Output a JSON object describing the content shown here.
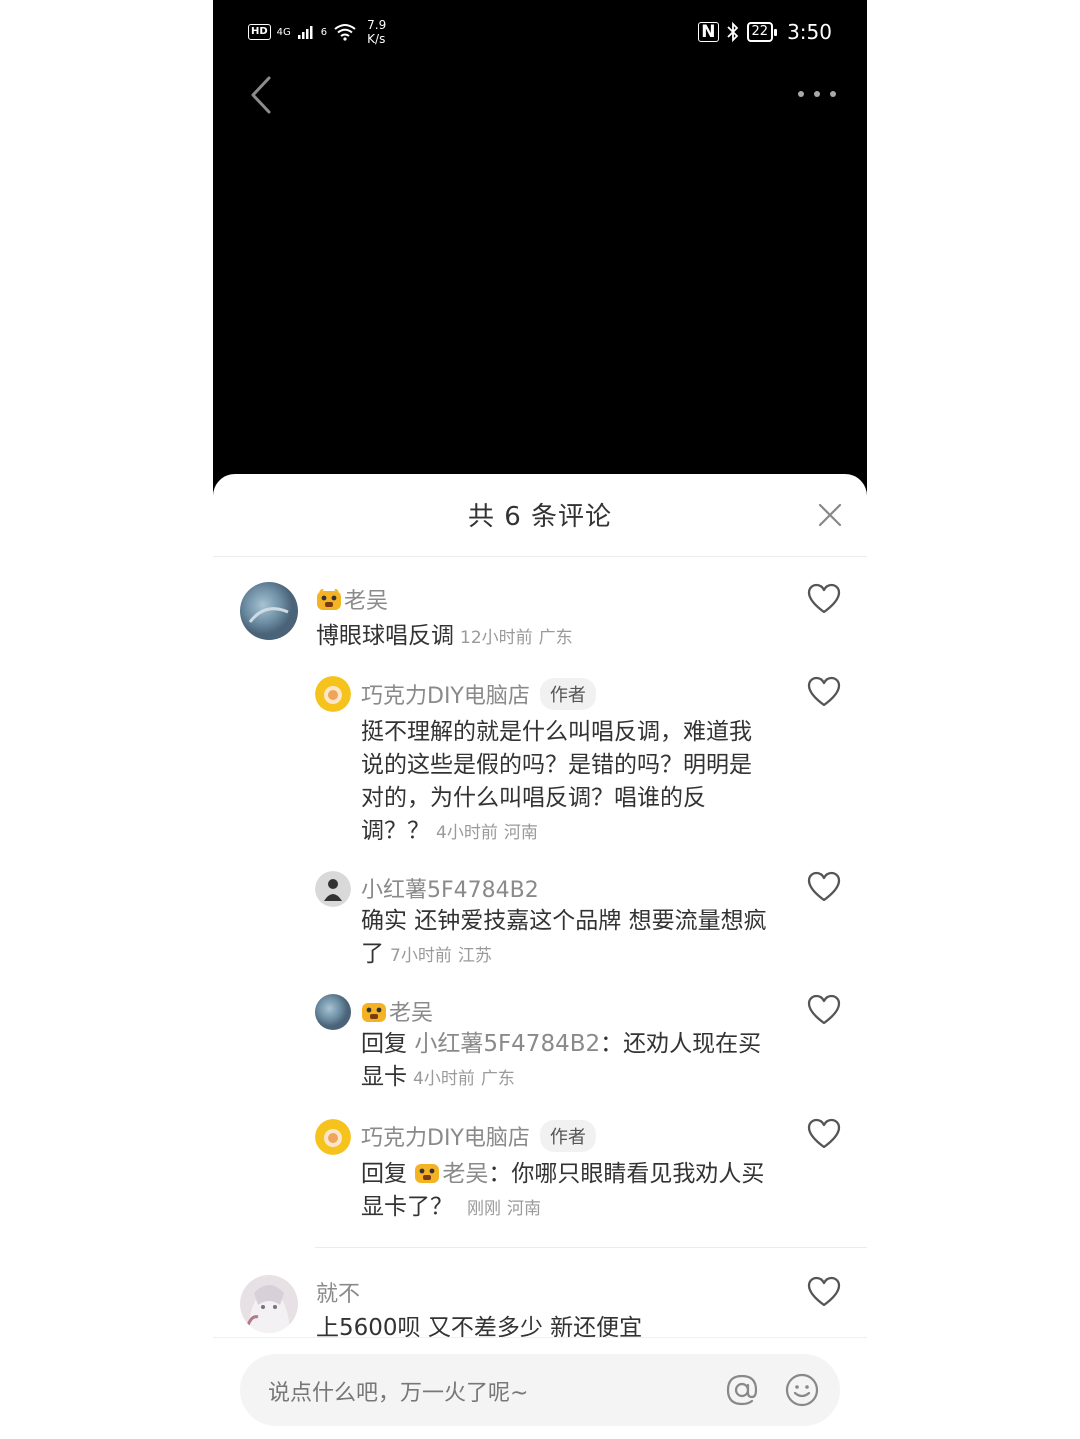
{
  "status_bar": {
    "hd": "HD",
    "network": "4G",
    "wifi_label": "6",
    "speed_value": "7.9",
    "speed_unit": "K/s",
    "nfc": "N",
    "battery": "22",
    "time": "3:50"
  },
  "icons": {
    "back": "chevron-left-icon",
    "more": "more-dots-icon",
    "close": "close-icon",
    "like": "heart-outline-icon",
    "at": "at-icon",
    "emoji": "smiley-icon"
  },
  "sheet": {
    "title": "共 6 条评论"
  },
  "comments": [
    {
      "username": "老吴",
      "has_tiger_emoji": true,
      "text": "博眼球唱反调",
      "time": "12小时前",
      "location": "广东"
    },
    {
      "username": "巧克力DIY电脑店",
      "badge": "作者",
      "text": "挺不理解的就是什么叫唱反调，难道我说的这些是假的吗？是错的吗？明明是对的，为什么叫唱反调？唱谁的反调？？",
      "time": "4小时前",
      "location": "河南"
    },
    {
      "username": "小红薯5F4784B2",
      "text": "确实 还钟爱技嘉这个品牌 想要流量想疯了",
      "time": "7小时前",
      "location": "江苏"
    },
    {
      "username": "老吴",
      "has_tiger_emoji": true,
      "reply_prefix": "回复",
      "reply_to": "小红薯5F4784B2",
      "text": "：还劝人现在买显卡",
      "time": "4小时前",
      "location": "广东"
    },
    {
      "username": "巧克力DIY电脑店",
      "badge": "作者",
      "reply_prefix": "回复",
      "reply_to": "老吴",
      "text": "：你哪只眼睛看见我劝人买显卡了？",
      "time": "刚刚",
      "location": "河南"
    },
    {
      "username": "就不",
      "text": "上5600呗 又不差多少 新还便宜"
    }
  ],
  "input": {
    "placeholder": "说点什么吧，万一火了呢~"
  },
  "colors": {
    "video_bg": "#000000",
    "sheet_bg": "#ffffff",
    "muted_text": "#8a8a8a",
    "body_text": "#333333"
  }
}
